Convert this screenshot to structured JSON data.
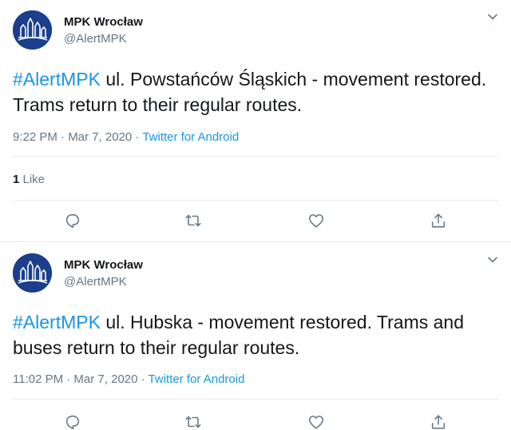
{
  "tweets": [
    {
      "author_name": "MPK Wrocław",
      "author_handle": "@AlertMPK",
      "hashtag": "#AlertMPK",
      "text": " ul. Powstańców Śląskich - movement restored. Trams return to their regular routes.",
      "time": "9:22 PM · Mar 7, 2020 · ",
      "source": "Twitter for Android",
      "likes_count": "1",
      "likes_label": " Like"
    },
    {
      "author_name": "MPK Wrocław",
      "author_handle": "@AlertMPK",
      "hashtag": "#AlertMPK",
      "text": " ul. Hubska - movement restored. Trams and buses return to their regular routes.",
      "time": "11:02 PM · Mar 7, 2020 · ",
      "source": "Twitter for Android"
    }
  ],
  "colors": {
    "accent": "#1b95e0",
    "secondary_text": "#657786",
    "avatar_bg": "#1b3f8c"
  },
  "icons": [
    "caret-down-icon",
    "reply-icon",
    "retweet-icon",
    "like-icon",
    "share-icon"
  ]
}
